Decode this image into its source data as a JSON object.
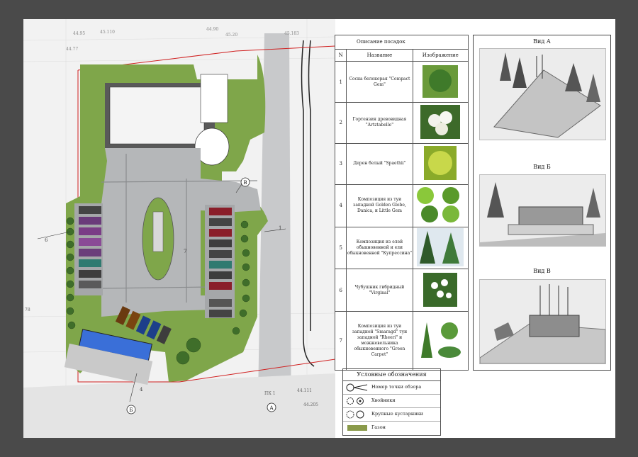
{
  "plan": {
    "elevations": [
      "44.95",
      "45.110",
      "44.90",
      "45.183",
      "45.20",
      "44.77"
    ],
    "point_labels": [
      "В",
      "Б",
      "А"
    ],
    "section_numbers": [
      "1",
      "2",
      "3",
      "4",
      "5",
      "6",
      "7",
      "1",
      "4",
      "6"
    ],
    "small_notes": [
      "78",
      "44.111",
      "44.205",
      "ПК 1"
    ]
  },
  "plants_table": {
    "caption": "Описание посадок",
    "headers": {
      "num": "N",
      "name": "Название",
      "image": "Изображение"
    },
    "rows": [
      {
        "num": "1",
        "name": "Сосна белокорая \"Compact Gem\""
      },
      {
        "num": "2",
        "name": "Гортензия древовидная \"Artztabelle\""
      },
      {
        "num": "3",
        "name": "Дерен белый \"Spaethii\""
      },
      {
        "num": "4",
        "name": "Композиция из туи западной Golden Globe, Danica, и Little Gem"
      },
      {
        "num": "5",
        "name": "Композиция из елей обыкновенной и ели обыкновенной \"Купрессина\""
      },
      {
        "num": "6",
        "name": "Чубушник гибридный \"Virginal\""
      },
      {
        "num": "7",
        "name": "Композиция из туи западной \"Smaragd\" туи западной \"Rheeri\" и можжевельника обыкновенного \"Green Carpet\""
      }
    ]
  },
  "views": [
    {
      "title": "Вид А"
    },
    {
      "title": "Вид Б"
    },
    {
      "title": "Вид В"
    }
  ],
  "legend": {
    "title": "Условные обозначения",
    "items": [
      {
        "label": "Номер точки обзора"
      },
      {
        "label": "Хвойники"
      },
      {
        "label": "Крупные кустарники"
      },
      {
        "label": "Газон"
      }
    ]
  },
  "colors": {
    "background": "#4a4a4a",
    "lawn": "#7fa64a",
    "paving": "#b5b7b9",
    "road": "#a7a9ab",
    "boundary": "#d02020"
  }
}
